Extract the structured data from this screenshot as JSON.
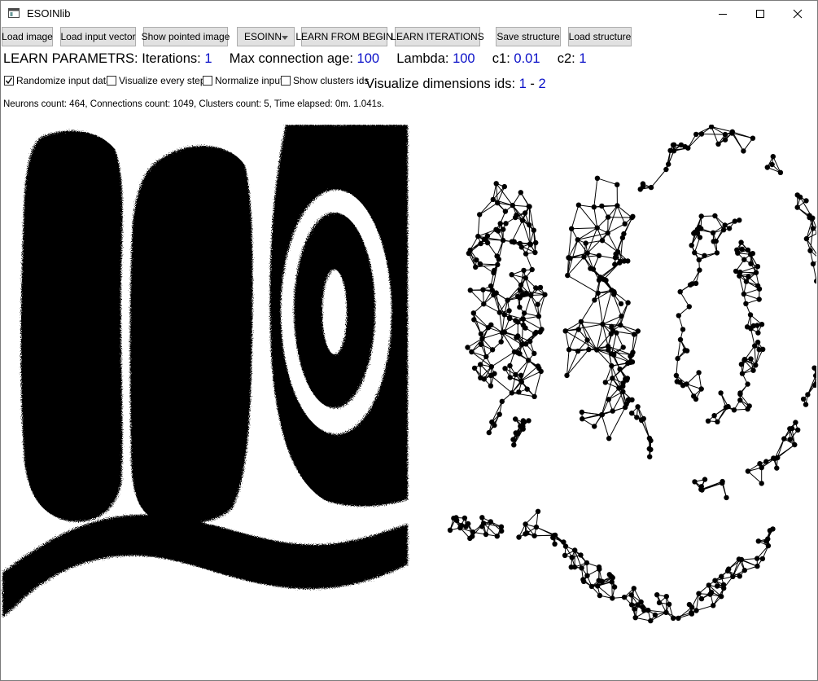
{
  "window": {
    "title": "ESOINlib"
  },
  "toolbar": {
    "load_image": "Load image",
    "load_input_vector": "Load input vector",
    "show_pointed_image": "Show pointed image",
    "algorithm_select": "ESOINN",
    "learn_from_begin": "LEARN FROM BEGIN",
    "learn_iterations": "LEARN ITERATIONS",
    "save_structure": "Save structure",
    "load_structure": "Load structure"
  },
  "params": {
    "heading": "LEARN PARAMETRS:",
    "iterations_label": "Iterations:",
    "iterations": "1",
    "max_age_label": "Max connection age:",
    "max_age": "100",
    "lambda_label": "Lambda:",
    "lambda": "100",
    "c1_label": "c1:",
    "c1": "0.01",
    "c2_label": "c2:",
    "c2": "1"
  },
  "options": {
    "randomize": {
      "label": "Randomize input data",
      "checked": true
    },
    "visualize_every_step": {
      "label": "Visualize every step",
      "checked": false
    },
    "normalize": {
      "label": "Normalize input",
      "checked": false
    },
    "show_clusters": {
      "label": "Show clusters ids",
      "checked": false
    }
  },
  "visualize_dims": {
    "label": "Visualize dimensions ids:",
    "from": "1",
    "separator": "-",
    "to": "2"
  },
  "status": "Neurons count: 464, Connections count: 1049, Clusters count: 5, Time elapsed: 0m. 1.041s.",
  "colors": {
    "value_blue": "#0a10c8",
    "button_bg": "#e1e1e1",
    "button_border": "#adadad"
  },
  "icons": {
    "app": "window-app-icon",
    "minimize": "minimize-icon",
    "maximize": "maximize-icon",
    "close": "close-icon",
    "dropdown": "chevron-down-icon"
  }
}
